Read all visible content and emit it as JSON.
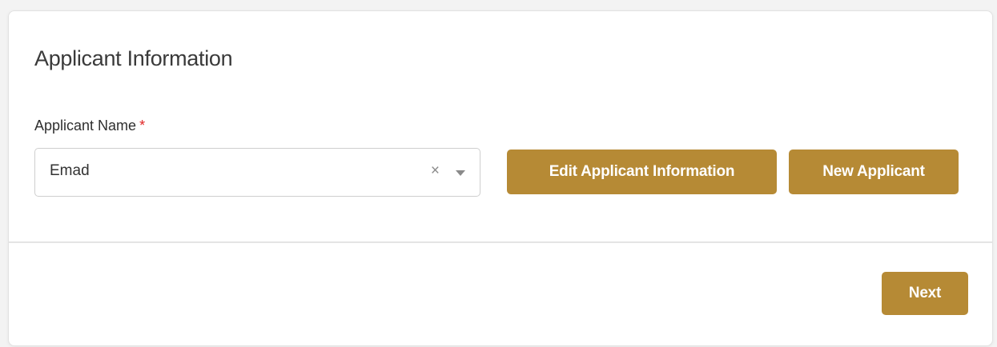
{
  "form": {
    "section_title": "Applicant Information",
    "applicant_name_label": "Applicant Name",
    "required_marker": "*",
    "applicant_name_value": "Emad",
    "clear_glyph": "×"
  },
  "actions": {
    "edit_label": "Edit Applicant Information",
    "new_label": "New Applicant",
    "next_label": "Next"
  },
  "colors": {
    "accent": "#b68a35",
    "required": "#e02424"
  },
  "icons": {
    "clear": "close-icon",
    "dropdown": "chevron-down-icon"
  }
}
